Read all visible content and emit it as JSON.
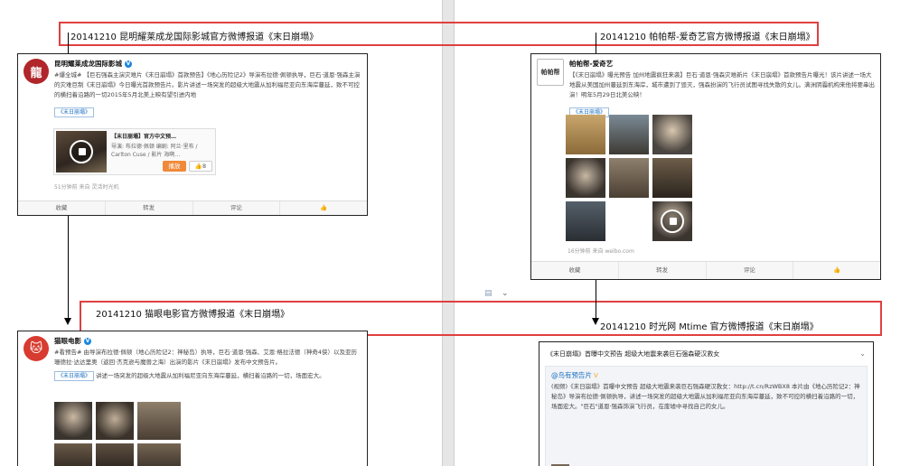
{
  "captions": {
    "top_left": "20141210  昆明耀莱成龙国际影城官方微博报道《末日崩塌》",
    "top_right": "20141210  帕帕帮-爱奇艺官方微博报道《末日崩塌》",
    "mid_left": "20141210  猫眼电影官方微博报道《末日崩塌》",
    "mid_right": "20141210 时光网 Mtime 官方微博报道《末日崩塌》"
  },
  "card_kunming": {
    "avatar_text": "龍",
    "username": "昆明耀莱成龙国际影城",
    "text": "#爆全城# 【巨石强森主演灾难片《末日崩塌》首款预告】《地心历险记2》导演布拉德·佩顿执导，巨石·道恩·强森主演的灾难巨制《末日崩塌》今日曝光首款预告片。影片讲述一场突发的超级大地震从加利福尼亚向东海岸蔓延，致不可控的横扫着沿路的一切2015年5月北美上映有望引进内地",
    "tag": "《末日崩塌》",
    "video_title": "【末日崩塌】官方中文预…",
    "video_desc": "导演: 布拉德·佩顿 编剧: 阿兰·里布 / Carlton Cuse / 影片 海啊…",
    "play_btn": "播放",
    "like_count": "8",
    "meta": "51分钟前 来自 灵活时光机",
    "actions": [
      "收藏",
      "转发",
      "评论",
      "👍"
    ]
  },
  "card_papa": {
    "avatar_text": "帕帕帮",
    "username": "帕帕帮-爱奇艺",
    "text": "【《末日崩塌》曝光预告 加州地震疯狂来袭】巨石·道恩·强森灾难新片《末日崩塌》首款预告片曝光！该片讲述一场大地震从美国加州蔓延到东海岸，城市遭到了毁灭，强森扮演的飞行员试图寻找失散的女儿。满洲阴霾机构来他将要串出演！明年5月29日北美公映！",
    "tag": "《末日崩塌》",
    "meta": "16分钟前 来自 weibo.com",
    "actions": [
      "收藏",
      "转发",
      "评论",
      "👍"
    ]
  },
  "card_maoyan": {
    "avatar_text": "🐱",
    "username": "猫眼电影",
    "text": "#看预告# 由导演布拉德·佩顿（地心历险记2：神秘岛）执导，巨石·道恩·强森、艾恩·格拉法德（神奇4侠）以及亚历珊德拉·达达里奥（返回·杰克逊与魔兽之海）出演的影片《末日崩塌》发布中文预告片。",
    "tag": "《末日崩塌》",
    "text2": "讲述一场突发的超级大地震从加利福尼亚向东海岸蔓延，横扫着沿路的一切，场面宏大。"
  },
  "card_mtime": {
    "head": "《末日崩塌》首曝中文预告 超级大地震来袭巨石强森硬汉救女",
    "username": "@鸟有预告片",
    "text": "(视频)《末日崩塌》首曝中文预告 超级大地震来袭巨石强森硬汉救女：http://t.cn/RzWBX8 本片由《地心历险记2：神秘岛》导演布拉德·佩顿执导，讲述一场突发的超级大地震从加利福尼亚向东海岸蔓延，致不可控的横扫着沿路的一切，场面宏大。\"巨石\"道恩·强森饰演飞行员，在废墟中寻找自己的女儿。",
    "collapse_icon": "chevron-down-icon"
  },
  "toolbar": {
    "icon": "document-icon",
    "caret": "⌄"
  }
}
